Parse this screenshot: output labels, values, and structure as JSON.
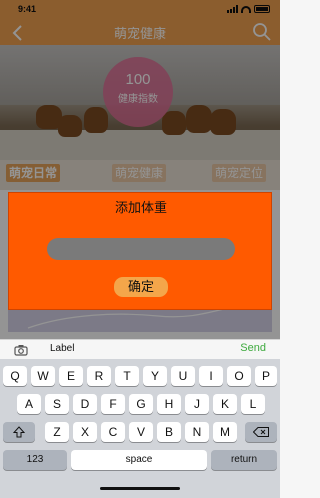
{
  "status": {
    "time": "9:41"
  },
  "nav": {
    "title": "萌宠健康"
  },
  "health": {
    "score": "100",
    "label": "健康指数"
  },
  "tabs": [
    {
      "label": "萌宠日常"
    },
    {
      "label": "萌宠健康"
    },
    {
      "label": "萌宠定位"
    }
  ],
  "dialog": {
    "title": "添加体重",
    "input_value": "",
    "confirm_label": "确定"
  },
  "keyboard_toolbar": {
    "label": "Label",
    "send": "Send"
  },
  "keyboard": {
    "row1": [
      "Q",
      "W",
      "E",
      "R",
      "T",
      "Y",
      "U",
      "I",
      "O",
      "P"
    ],
    "row2": [
      "A",
      "S",
      "D",
      "F",
      "G",
      "H",
      "J",
      "K",
      "L"
    ],
    "row3": [
      "Z",
      "X",
      "C",
      "V",
      "B",
      "N",
      "M"
    ],
    "numbers_label": "123",
    "space_label": "space",
    "return_label": "return"
  },
  "colors": {
    "brand": "#f0a050",
    "dialog": "#ff5a00",
    "confirm": "#f4a64a",
    "send": "#3eaa3e"
  }
}
